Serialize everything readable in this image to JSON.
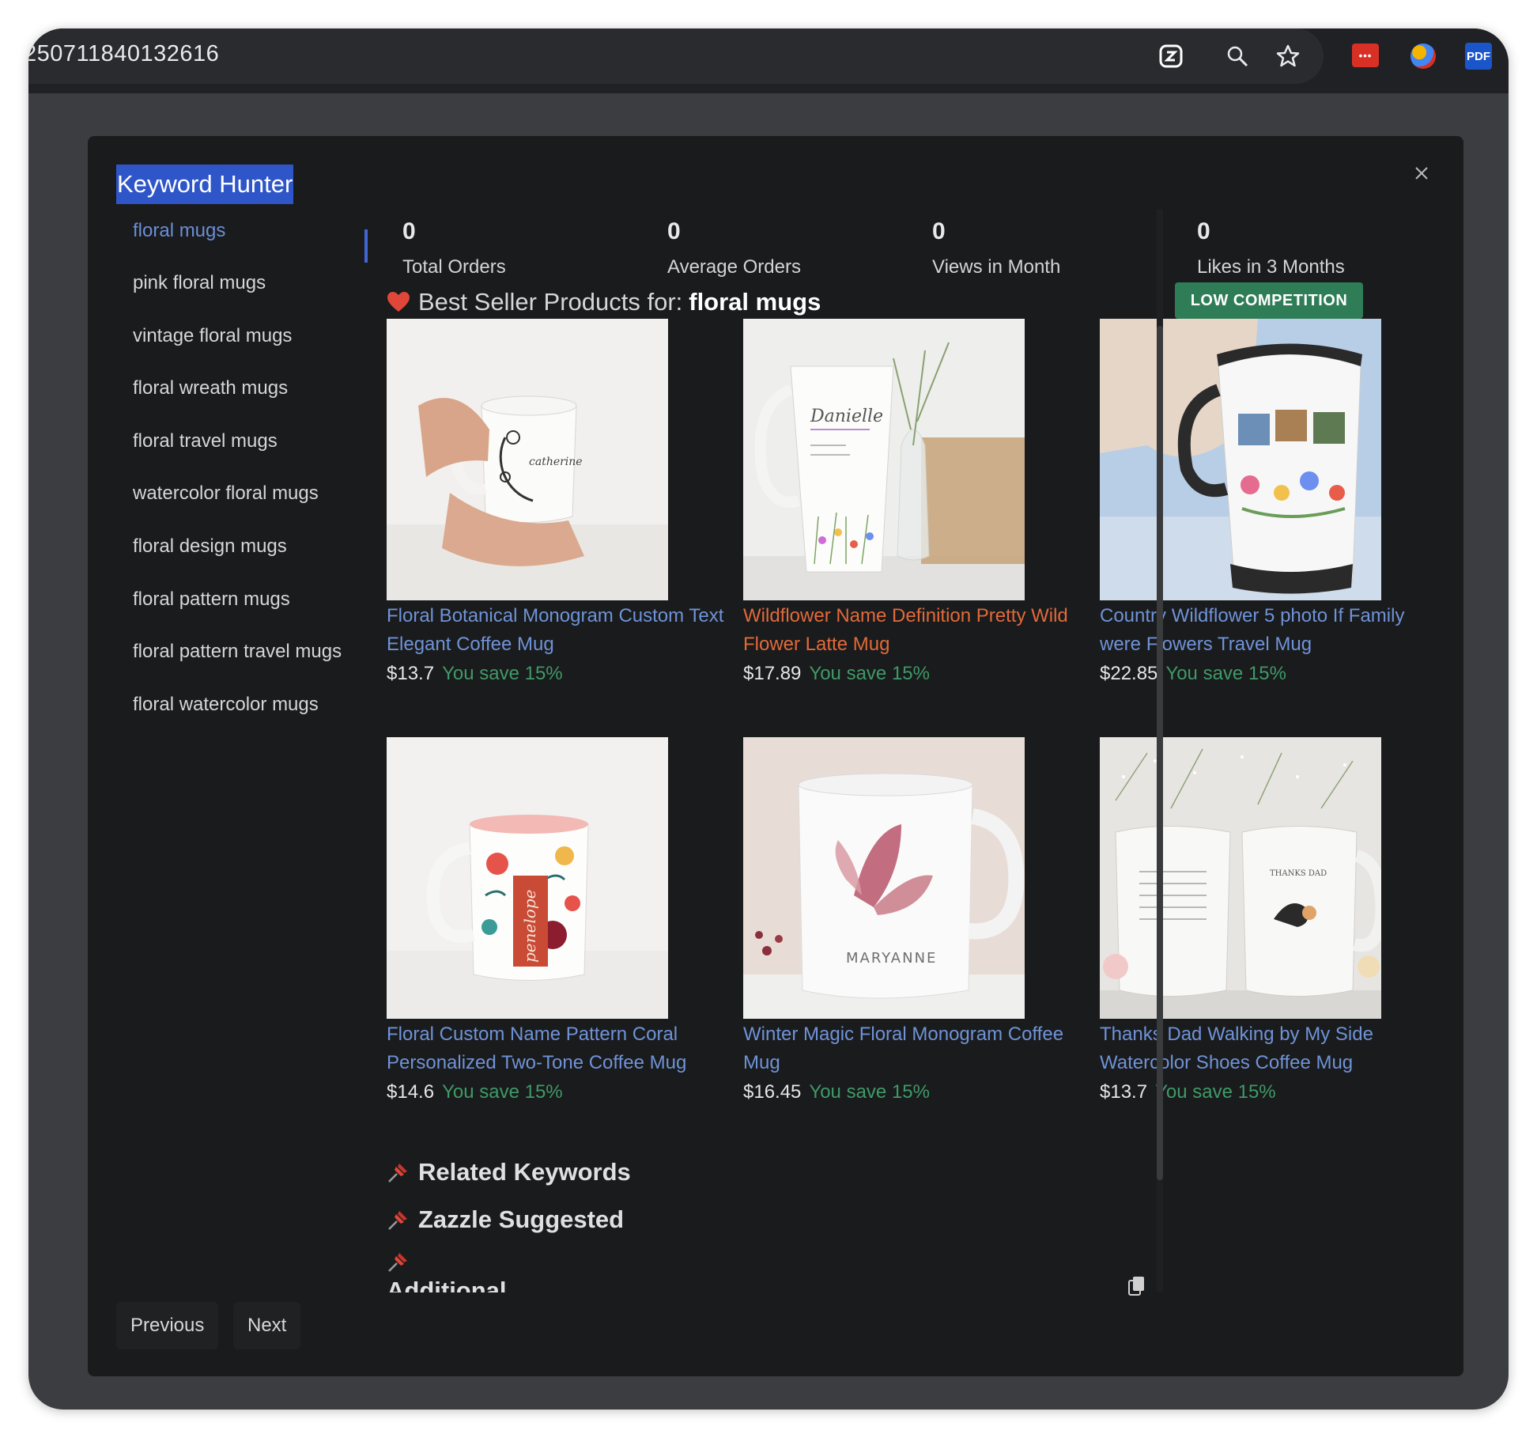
{
  "browser": {
    "url_fragment": "250711840132616",
    "extension_red_label": "•••",
    "extension_pdf_label": "PDF"
  },
  "modal": {
    "title": "Keyword Hunter"
  },
  "keywords": [
    {
      "label": "floral mugs",
      "active": true
    },
    {
      "label": "pink floral mugs",
      "active": false
    },
    {
      "label": "vintage floral mugs",
      "active": false
    },
    {
      "label": "floral wreath mugs",
      "active": false
    },
    {
      "label": "floral travel mugs",
      "active": false
    },
    {
      "label": "watercolor floral mugs",
      "active": false
    },
    {
      "label": "floral design mugs",
      "active": false
    },
    {
      "label": "floral pattern mugs",
      "active": false
    },
    {
      "label": "floral pattern travel mugs",
      "active": false
    },
    {
      "label": "floral watercolor mugs",
      "active": false
    }
  ],
  "stats": [
    {
      "value": "0",
      "label": "Total Orders"
    },
    {
      "value": "0",
      "label": "Average Orders"
    },
    {
      "value": "0",
      "label": "Views in Month"
    },
    {
      "value": "0",
      "label": "Likes in 3 Months"
    }
  ],
  "best_seller": {
    "prefix": "Best Seller Products for:",
    "keyword": "floral mugs",
    "competition_badge": "LOW COMPETITION"
  },
  "products": [
    {
      "title": "Floral Botanical Monogram Custom Text Elegant Coffee Mug",
      "price": "$13.7",
      "save": "You save 15%",
      "title_color": "blue"
    },
    {
      "title": "Wildflower Name Definition Pretty Wild Flower Latte Mug",
      "price": "$17.89",
      "save": "You save 15%",
      "title_color": "orange"
    },
    {
      "title": "Country Wildflower 5 photo If Family were Flowers Travel Mug",
      "price": "$22.85",
      "save": "You save 15%",
      "title_color": "blue"
    },
    {
      "title": "Floral Custom Name Pattern Coral Personalized Two-Tone Coffee Mug",
      "price": "$14.6",
      "save": "You save 15%",
      "title_color": "blue"
    },
    {
      "title": "Winter Magic Floral Monogram Coffee Mug",
      "price": "$16.45",
      "save": "You save 15%",
      "title_color": "blue"
    },
    {
      "title": "Thanks Dad Walking by My Side Watercolor Shoes Coffee Mug",
      "price": "$13.7",
      "save": "You save 15%",
      "title_color": "blue"
    }
  ],
  "mug_prints": {
    "catherine": "catherine",
    "danielle": "Danielle",
    "penelope": "penelope",
    "maryanne": "MARYANNE",
    "thanks_dad": "THANKS DAD"
  },
  "sections": {
    "related": "Related Keywords",
    "zazzle": "Zazzle Suggested",
    "additional": "Additional"
  },
  "nav": {
    "previous": "Previous",
    "next": "Next"
  },
  "colors": {
    "accent_blue": "#2f56c9",
    "link_blue": "#6f93d8",
    "link_orange": "#e26a3a",
    "save_green": "#3f9a68",
    "badge_green": "#2f7d57"
  }
}
